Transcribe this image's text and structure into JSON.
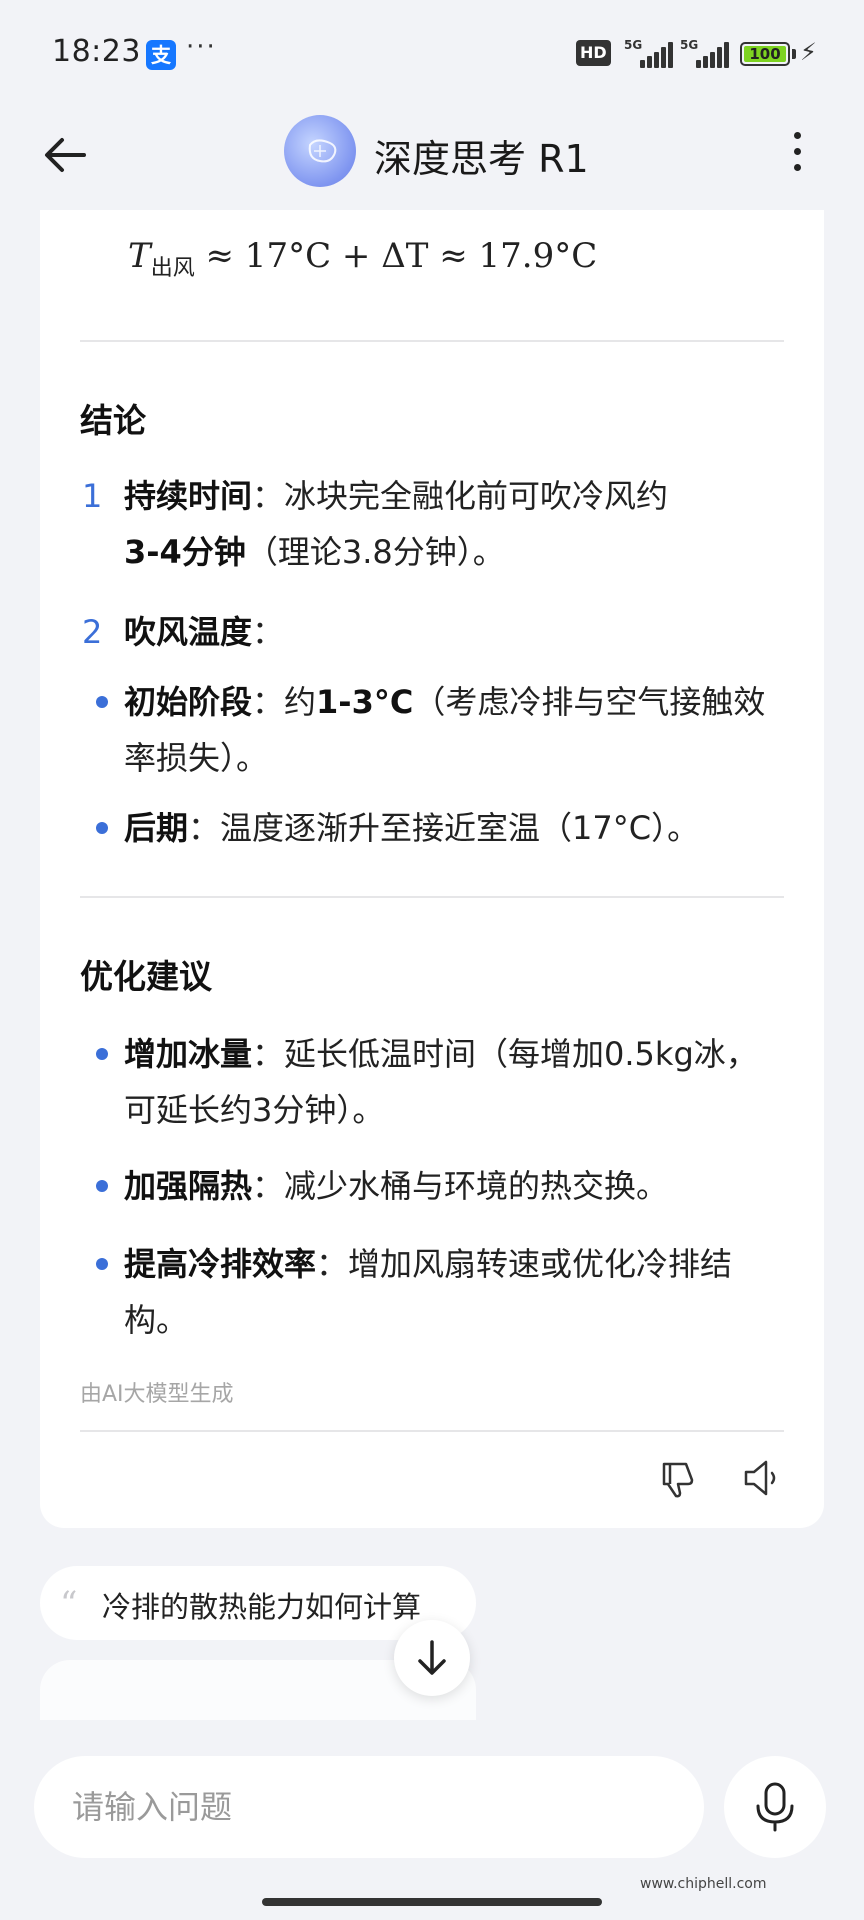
{
  "status_bar": {
    "time": "18:23",
    "alipay_glyph": "支",
    "more": "···",
    "hd": "HD",
    "sig1": "5G",
    "sig2": "5G",
    "battery": "100",
    "icons": [
      "alipay-icon",
      "signal-icon",
      "battery-icon",
      "charging-icon"
    ]
  },
  "header": {
    "title": "深度思考 R1",
    "icons": [
      "back-arrow-icon",
      "brain-avatar-icon",
      "more-vertical-icon"
    ]
  },
  "message": {
    "formula": {
      "lhs": "T",
      "sub": "出风",
      "rhs": " ≈ 17°C + ΔT ≈ 17.9°C"
    },
    "conclusion": {
      "title": "结论",
      "items": [
        {
          "marker": "1",
          "bold": "持续时间",
          "text_a": "：冰块完全融化前可吹冷风约",
          "bold2": "3-4分钟",
          "text_b": "（理论3.8分钟）。"
        },
        {
          "marker": "2",
          "bold": "吹风温度",
          "text_a": "："
        }
      ],
      "bullets": [
        {
          "bold": "初始阶段",
          "text_a": "：约",
          "bold2": "1-3°C",
          "text_b": "（考虑冷排与空气接触效率损失）。"
        },
        {
          "bold": "后期",
          "text_a": "：温度逐渐升至接近室温（17°C）。"
        }
      ]
    },
    "suggestions_section": {
      "title": "优化建议",
      "bullets": [
        {
          "bold": "增加冰量",
          "text": "：延长低温时间（每增加0.5kg冰，可延长约3分钟）。"
        },
        {
          "bold": "加强隔热",
          "text": "：减少水桶与环境的热交换。"
        },
        {
          "bold": "提高冷排效率",
          "text": "：增加风扇转速或优化冷排结构。"
        }
      ]
    },
    "ai_note": "由AI大模型生成",
    "actions": [
      "thumbs-down-icon",
      "speaker-icon"
    ]
  },
  "follow_ups": {
    "first": "冷排的散热能力如何计算",
    "icons": [
      "quote-icon",
      "arrow-down-icon"
    ]
  },
  "input": {
    "placeholder": "请输入问题",
    "icons": [
      "microphone-icon"
    ]
  },
  "watermark": "www.chiphell.com"
}
